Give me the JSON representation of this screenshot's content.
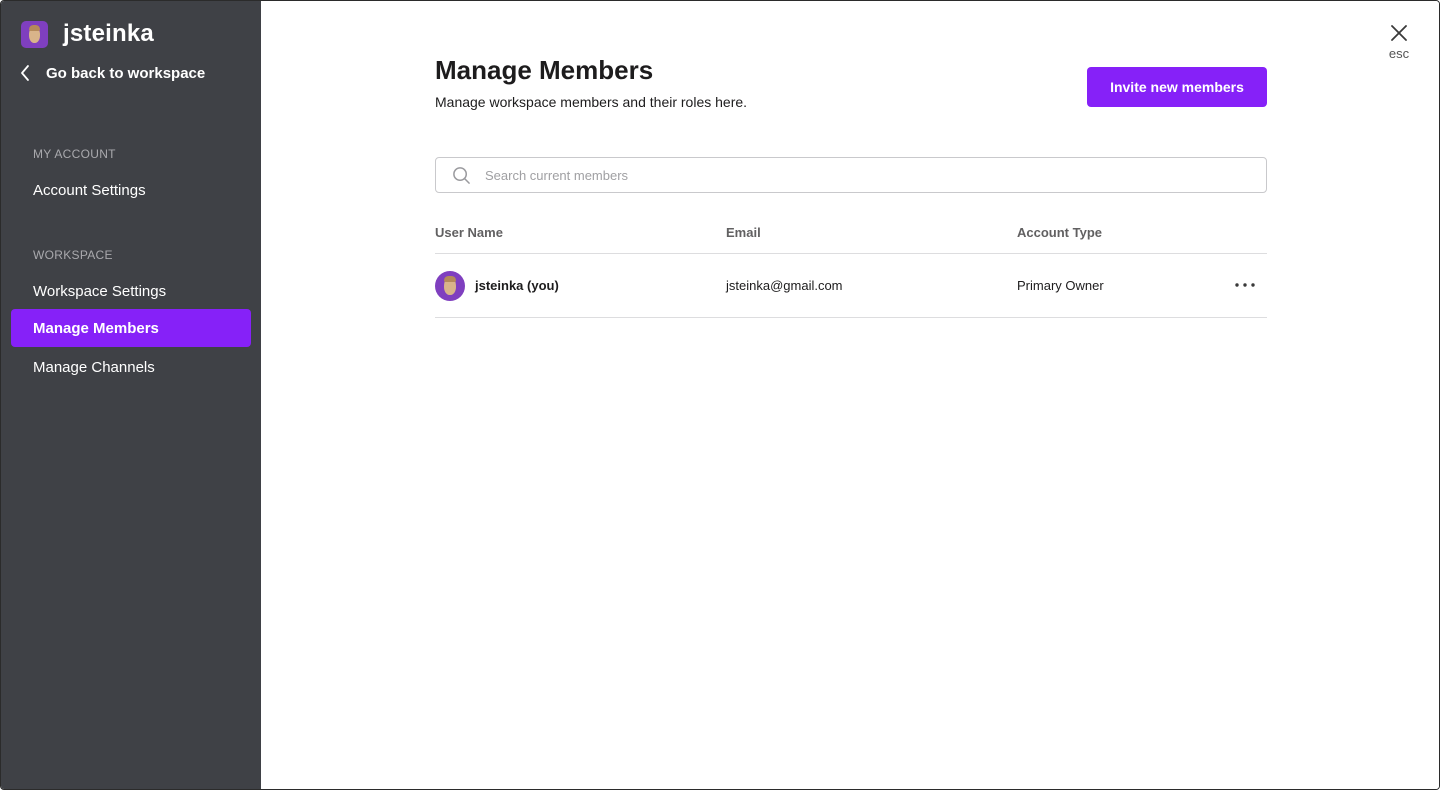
{
  "sidebar": {
    "workspace_name": "jsteinka",
    "back_label": "Go back to workspace",
    "sections": [
      {
        "title": "MY ACCOUNT",
        "items": [
          {
            "label": "Account Settings",
            "active": false
          }
        ]
      },
      {
        "title": "WORKSPACE",
        "items": [
          {
            "label": "Workspace Settings",
            "active": false
          },
          {
            "label": "Manage Members",
            "active": true
          },
          {
            "label": "Manage Channels",
            "active": false
          }
        ]
      }
    ]
  },
  "header": {
    "title": "Manage Members",
    "subtitle": "Manage workspace members and their roles here.",
    "invite_label": "Invite new members",
    "close_hint": "esc"
  },
  "search": {
    "placeholder": "Search current members",
    "value": ""
  },
  "table": {
    "columns": [
      "User Name",
      "Email",
      "Account Type"
    ],
    "rows": [
      {
        "name": "jsteinka (you)",
        "email": "jsteinka@gmail.com",
        "account_type": "Primary Owner"
      }
    ]
  },
  "icons": {
    "back": "chevron-left-icon",
    "close": "close-icon",
    "search": "search-icon",
    "more": "more-horizontal-icon"
  },
  "colors": {
    "sidebar_bg": "#3f4146",
    "accent": "#8621f8",
    "avatar_bg": "#7f3fbf"
  }
}
